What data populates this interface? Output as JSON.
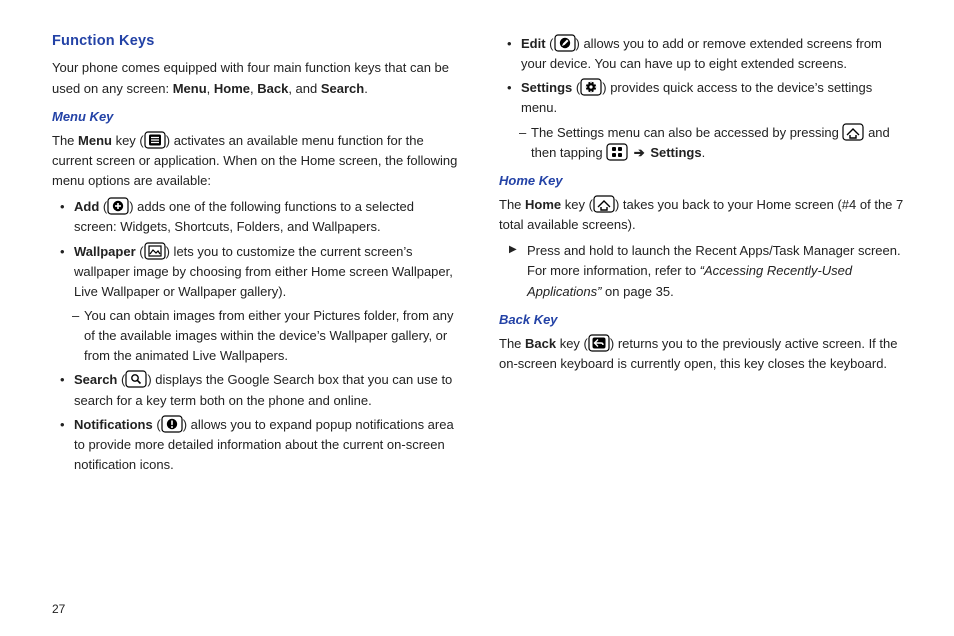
{
  "pageNumber": "27",
  "left": {
    "heading": "Function Keys",
    "intro_1": "Your phone comes equipped with four main function keys that can be used on any screen: ",
    "intro_keys": [
      "Menu",
      "Home",
      "Back",
      "Search"
    ],
    "intro_period": ".",
    "menuKey": {
      "heading": "Menu Key",
      "p1_a": "The ",
      "p1_b": "Menu",
      "p1_c": " key (",
      "p1_d": ") activates an available menu function for the current screen or application. When on the Home screen, the following menu options are available:",
      "add_label": "Add",
      "add_text_a": " (",
      "add_text_b": ") adds one of the following functions to a selected screen: Widgets, Shortcuts, Folders, and Wallpapers.",
      "wall_label": "Wallpaper",
      "wall_text_a": " (",
      "wall_text_b": ") lets you to customize the current screen’s wallpaper image by choosing from either Home screen Wallpaper, Live Wallpaper or Wallpaper gallery).",
      "wall_sub": "You can obtain images from either your Pictures folder, from any of the available images within the device’s Wallpaper gallery, or from the animated Live Wallpapers.",
      "search_label": "Search",
      "search_text_a": " (",
      "search_text_b": ") displays the Google Search box that you can use to search for a key term both on the phone and online.",
      "notif_label": "Notifications",
      "notif_text_a": " (",
      "notif_text_b": ") allows you to expand popup notifications area to provide more detailed information about the current on-screen notification icons."
    }
  },
  "right": {
    "edit_label": "Edit",
    "edit_text_a": " (",
    "edit_text_b": ") allows you to add or remove extended screens from your device. You can have up to eight extended screens.",
    "settings_label": "Settings",
    "settings_text_a": " (",
    "settings_text_b": ") provides quick access to the device’s settings menu.",
    "settings_sub_a": "The Settings menu can also be accessed by pressing ",
    "settings_sub_b": " and then tapping ",
    "settings_sub_c": "Settings",
    "settings_sub_d": ".",
    "homeKey": {
      "heading": "Home Key",
      "p_a": "The ",
      "p_b": "Home",
      "p_c": " key (",
      "p_d": ") takes you back to your Home screen (#4 of the 7 total available screens).",
      "tri_a": "Press and hold to launch the Recent Apps/Task Manager screen. For more information, refer to ",
      "tri_ref": "“Accessing Recently-Used Applications”",
      "tri_b": "  on page 35."
    },
    "backKey": {
      "heading": "Back Key",
      "p_a": "The ",
      "p_b": "Back",
      "p_c": " key (",
      "p_d": ") returns you to the previously active screen. If the on-screen keyboard is currently open, this key closes the keyboard."
    }
  }
}
